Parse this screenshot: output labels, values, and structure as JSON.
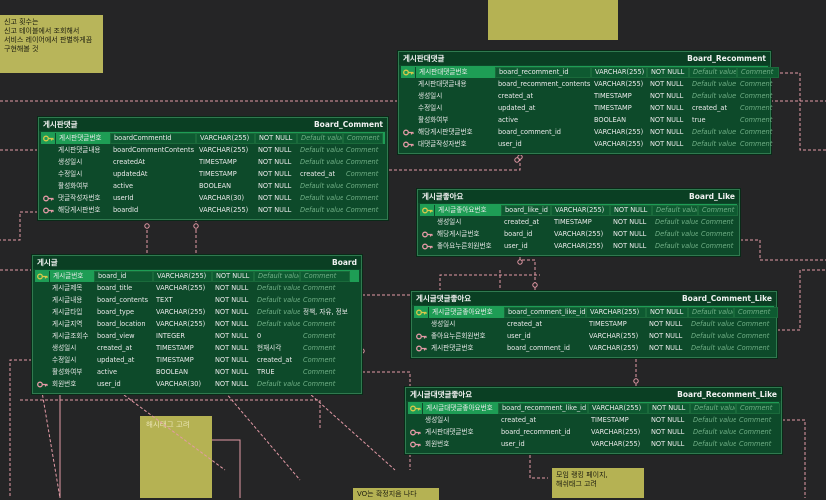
{
  "notes": {
    "report": "신고 횟수는\n신고 테이블에서 조회해서\n서비스 레이어에서 판별하게끔\n구현해볼 것",
    "hashtag": "해시태그 고려",
    "ranking": "모임 랭킹 페이지,\n해쉬태그 고려",
    "bottom": "VO는 확정지음 나다"
  },
  "placeholders": {
    "default": "Default value",
    "comment": "Comment"
  },
  "entities": {
    "board_recomment": {
      "logical": "게시판대댓글",
      "physical": "Board_Recomment",
      "rows": [
        {
          "logical": "게시판대댓글번호",
          "physical": "board_recomment_id",
          "type": "VARCHAR(255)",
          "nn": "NOT NULL",
          "pk": true
        },
        {
          "logical": "게시판대댓글내용",
          "physical": "board_recomment_contents",
          "type": "VARCHAR(255)",
          "nn": "NOT NULL"
        },
        {
          "logical": "생성일시",
          "physical": "created_at",
          "type": "TIMESTAMP",
          "nn": "NOT NULL"
        },
        {
          "logical": "수정일시",
          "physical": "updated_at",
          "type": "TIMESTAMP",
          "nn": "NOT NULL",
          "def": "created_at"
        },
        {
          "logical": "활성화여부",
          "physical": "active",
          "type": "BOOLEAN",
          "nn": "NOT NULL",
          "def": "true"
        },
        {
          "logical": "해당게시판댓글번호",
          "physical": "board_comment_id",
          "type": "VARCHAR(255)",
          "nn": "NOT NULL",
          "fk": true
        },
        {
          "logical": "대댓글작성자번호",
          "physical": "user_id",
          "type": "VARCHAR(255)",
          "nn": "NOT NULL",
          "fk": true
        }
      ]
    },
    "board_comment": {
      "logical": "게시판댓글",
      "physical": "Board_Comment",
      "rows": [
        {
          "logical": "게시판댓글번호",
          "physical": "boardCommentId",
          "type": "VARCHAR(255)",
          "nn": "NOT NULL",
          "pk": true
        },
        {
          "logical": "게시판댓글내용",
          "physical": "boardCommentContents",
          "type": "VARCHAR(255)",
          "nn": "NOT NULL"
        },
        {
          "logical": "생성일시",
          "physical": "createdAt",
          "type": "TIMESTAMP",
          "nn": "NOT NULL"
        },
        {
          "logical": "수정일시",
          "physical": "updatedAt",
          "type": "TIMESTAMP",
          "nn": "NOT NULL",
          "def": "created_at"
        },
        {
          "logical": "활성화여부",
          "physical": "active",
          "type": "BOOLEAN",
          "nn": "NOT NULL"
        },
        {
          "logical": "댓글작성자번호",
          "physical": "userId",
          "type": "VARCHAR(30)",
          "nn": "NOT NULL",
          "fk": true
        },
        {
          "logical": "해당게시판번호",
          "physical": "boardId",
          "type": "VARCHAR(255)",
          "nn": "NOT NULL",
          "fk": true
        }
      ]
    },
    "board_like": {
      "logical": "게시글좋아요",
      "physical": "Board_Like",
      "rows": [
        {
          "logical": "게시글좋아요번호",
          "physical": "board_like_id",
          "type": "VARCHAR(255)",
          "nn": "NOT NULL",
          "pk": true
        },
        {
          "logical": "생성일시",
          "physical": "created_at",
          "type": "TIMESTAMP",
          "nn": "NOT NULL"
        },
        {
          "logical": "해당게시글번호",
          "physical": "board_id",
          "type": "VARCHAR(255)",
          "nn": "NOT NULL",
          "fk": true
        },
        {
          "logical": "좋아요누른회원번호",
          "physical": "user_id",
          "type": "VARCHAR(255)",
          "nn": "NOT NULL",
          "fk": true
        }
      ]
    },
    "board": {
      "logical": "게시글",
      "physical": "Board",
      "rows": [
        {
          "logical": "게시글번호",
          "physical": "board_id",
          "type": "VARCHAR(255)",
          "nn": "NOT NULL",
          "pk": true
        },
        {
          "logical": "게시글제목",
          "physical": "board_title",
          "type": "VARCHAR(255)",
          "nn": "NOT NULL"
        },
        {
          "logical": "게시글내용",
          "physical": "board_contents",
          "type": "TEXT",
          "nn": "NOT NULL"
        },
        {
          "logical": "게시글타입",
          "physical": "board_type",
          "type": "VARCHAR(255)",
          "nn": "NOT NULL",
          "cmt": "정책, 자유, 정보"
        },
        {
          "logical": "게시글지역",
          "physical": "board_location",
          "type": "VARCHAR(255)",
          "nn": "NOT NULL"
        },
        {
          "logical": "게시글조회수",
          "physical": "board_view",
          "type": "INTEGER",
          "nn": "NOT NULL",
          "def": "0"
        },
        {
          "logical": "생성일시",
          "physical": "created_at",
          "type": "TIMESTAMP",
          "nn": "NOT NULL",
          "def": "현재시각"
        },
        {
          "logical": "수정일시",
          "physical": "updated_at",
          "type": "TIMESTAMP",
          "nn": "NOT NULL",
          "def": "created_at"
        },
        {
          "logical": "활성화여부",
          "physical": "active",
          "type": "BOOLEAN",
          "nn": "NOT NULL",
          "def": "TRUE"
        },
        {
          "logical": "회원번호",
          "physical": "user_id",
          "type": "VARCHAR(30)",
          "nn": "NOT NULL",
          "fk": true
        }
      ]
    },
    "board_comment_like": {
      "logical": "게시글댓글좋아요",
      "physical": "Board_Comment_Like",
      "rows": [
        {
          "logical": "게시글댓글좋아요번호",
          "physical": "board_comment_like_id",
          "type": "VARCHAR(255)",
          "nn": "NOT NULL",
          "pk": true
        },
        {
          "logical": "생성일시",
          "physical": "created_at",
          "type": "TIMESTAMP",
          "nn": "NOT NULL"
        },
        {
          "logical": "좋아요누른회원번호",
          "physical": "user_id",
          "type": "VARCHAR(255)",
          "nn": "NOT NULL",
          "fk": true
        },
        {
          "logical": "게시판댓글번호",
          "physical": "board_comment_id",
          "type": "VARCHAR(255)",
          "nn": "NOT NULL",
          "fk": true
        }
      ]
    },
    "board_recomment_like": {
      "logical": "게시글대댓글좋아요",
      "physical": "Board_Recomment_Like",
      "rows": [
        {
          "logical": "게시글대댓글좋아요번호",
          "physical": "board_recomment_like_id",
          "type": "VARCHAR(255)",
          "nn": "NOT NULL",
          "pk": true
        },
        {
          "logical": "생성일시",
          "physical": "created_at",
          "type": "TIMESTAMP",
          "nn": "NOT NULL"
        },
        {
          "logical": "게시판대댓글번호",
          "physical": "board_recomment_id",
          "type": "VARCHAR(255)",
          "nn": "NOT NULL",
          "fk": true
        },
        {
          "logical": "회원번호",
          "physical": "user_id",
          "type": "VARCHAR(255)",
          "nn": "NOT NULL",
          "fk": true
        }
      ]
    }
  },
  "colors": {
    "canvas": "#252526",
    "entity_body": "#0d4a2a",
    "pk_row": "#1e9d55",
    "relationship_line": "#e39aa6",
    "note": "#b8b55a",
    "key_icon": "#d8c84a",
    "fk_icon": "#e39aa6"
  }
}
